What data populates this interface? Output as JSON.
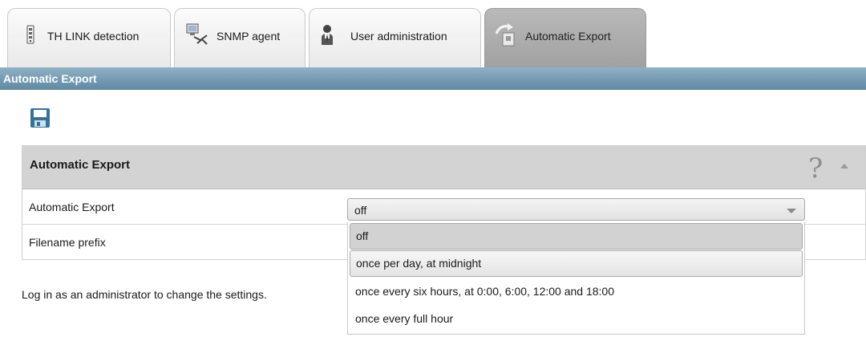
{
  "tabs": [
    {
      "label": "TH LINK detection",
      "icon": "device-icon"
    },
    {
      "label": "SNMP agent",
      "icon": "network-icon"
    },
    {
      "label": "User administration",
      "icon": "user-icon"
    },
    {
      "label": "Automatic Export",
      "icon": "export-icon",
      "active": true
    }
  ],
  "section": {
    "title": "Automatic Export"
  },
  "toolbar": {
    "save_icon": "save-icon"
  },
  "panel": {
    "title": "Automatic Export",
    "help_label": "?",
    "rows": [
      {
        "label": "Automatic Export"
      },
      {
        "label": "Filename prefix"
      }
    ]
  },
  "select": {
    "value": "off",
    "options": [
      "off",
      "once per day, at midnight",
      "once every six hours, at 0:00, 6:00, 12:00 and 18:00",
      "once every full hour"
    ]
  },
  "info": {
    "text": "Log in as an administrator to change the settings."
  },
  "colors": {
    "section_bar": "#6f97b0",
    "panel_head": "#d3d3d3",
    "active_tab": "#a8a8a8"
  }
}
